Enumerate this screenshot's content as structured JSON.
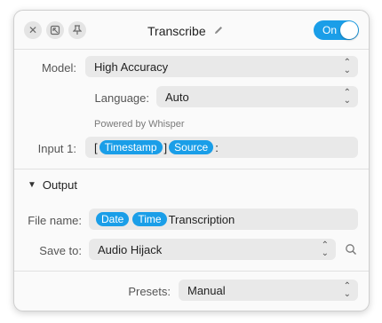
{
  "titlebar": {
    "title": "Transcribe",
    "toggle_label": "On",
    "close_icon": "close-icon",
    "popout_icon": "popout-icon",
    "pin_icon": "pin-icon",
    "edit_icon": "pencil-icon"
  },
  "model": {
    "label": "Model:",
    "value": "High Accuracy"
  },
  "language": {
    "label": "Language:",
    "value": "Auto"
  },
  "powered_by": "Powered by Whisper",
  "input1": {
    "label": "Input 1:",
    "open_bracket": "[",
    "chip1": "Timestamp",
    "close_bracket": "]",
    "chip2": "Source",
    "suffix": ":"
  },
  "output": {
    "section_title": "Output"
  },
  "file_name": {
    "label": "File name:",
    "chip1": "Date",
    "chip2": "Time",
    "text": "Transcription"
  },
  "save_to": {
    "label": "Save to:",
    "value": "Audio Hijack"
  },
  "presets": {
    "label": "Presets:",
    "value": "Manual"
  },
  "colors": {
    "accent": "#1a9ee8",
    "field_bg": "#e9e9e9"
  }
}
